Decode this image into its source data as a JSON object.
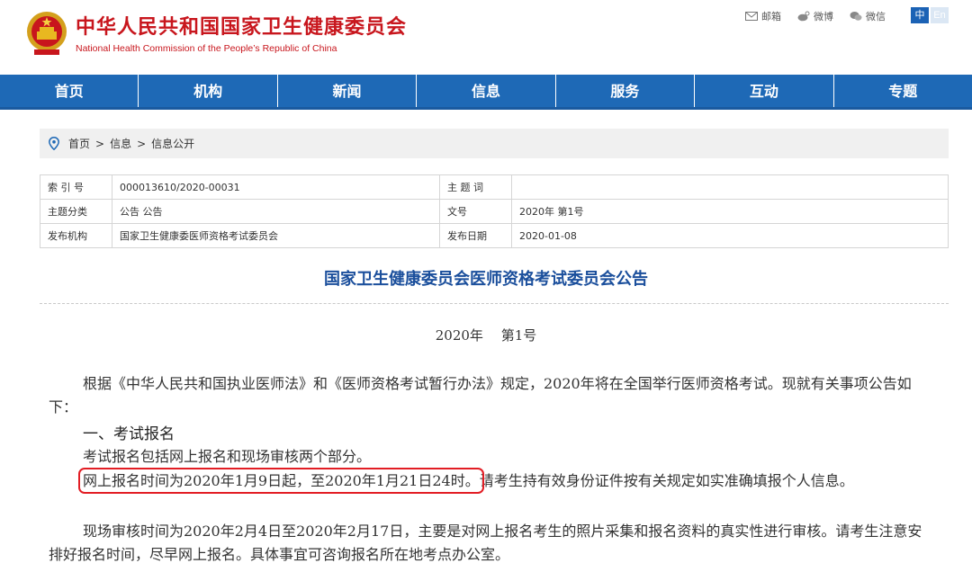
{
  "header": {
    "title_cn": "中华人民共和国国家卫生健康委员会",
    "title_en": "National Health Commission of the People’s Republic of China",
    "emblem_icon": "national-emblem-icon",
    "links": [
      {
        "label": "邮箱",
        "icon": "mail-icon"
      },
      {
        "label": "微博",
        "icon": "weibo-icon"
      },
      {
        "label": "微信",
        "icon": "wechat-icon"
      }
    ],
    "lang_zh": "中",
    "lang_en": "En"
  },
  "nav": [
    "首页",
    "机构",
    "新闻",
    "信息",
    "服务",
    "互动",
    "专题"
  ],
  "breadcrumb": {
    "icon": "location-pin-icon",
    "items": [
      "首页",
      "信息",
      "信息公开"
    ],
    "separator": ">"
  },
  "info": {
    "rows": [
      {
        "l1": "索 引 号",
        "v1": "000013610/2020-00031",
        "l2": "主 题 词",
        "v2": ""
      },
      {
        "l1": "主题分类",
        "v1": "公告 公告",
        "l2": "文号",
        "v2": "2020年 第1号"
      },
      {
        "l1": "发布机构",
        "v1": "国家卫生健康委医师资格考试委员会",
        "l2": "发布日期",
        "v2": "2020-01-08"
      }
    ]
  },
  "doc": {
    "title": "国家卫生健康委员会医师资格考试委员会公告",
    "number": "2020年　 第1号",
    "p1": "根据《中华人民共和国执业医师法》和《医师资格考试暂行办法》规定，2020年将在全国举行医师资格考试。现就有关事项公告如下：",
    "h1": "一、考试报名",
    "p2": "考试报名包括网上报名和现场审核两个部分。",
    "p3_highlight": "网上报名时间为2020年1月9日起，至2020年1月21日24时。",
    "p3_rest": "请考生持有效身份证件按有关规定如实准确填报个人信息。",
    "p4": "现场审核时间为2020年2月4日至2020年2月17日，主要是对网上报名考生的照片采集和报名资料的真实性进行审核。请考生注意安排好报名时间，尽早网上报名。具体事宜可咨询报名所在地考点办公室。"
  },
  "colors": {
    "brand_red": "#c8161d",
    "nav_blue": "#1e69b6",
    "title_blue": "#1b4f9c",
    "highlight": "#e21d24"
  }
}
